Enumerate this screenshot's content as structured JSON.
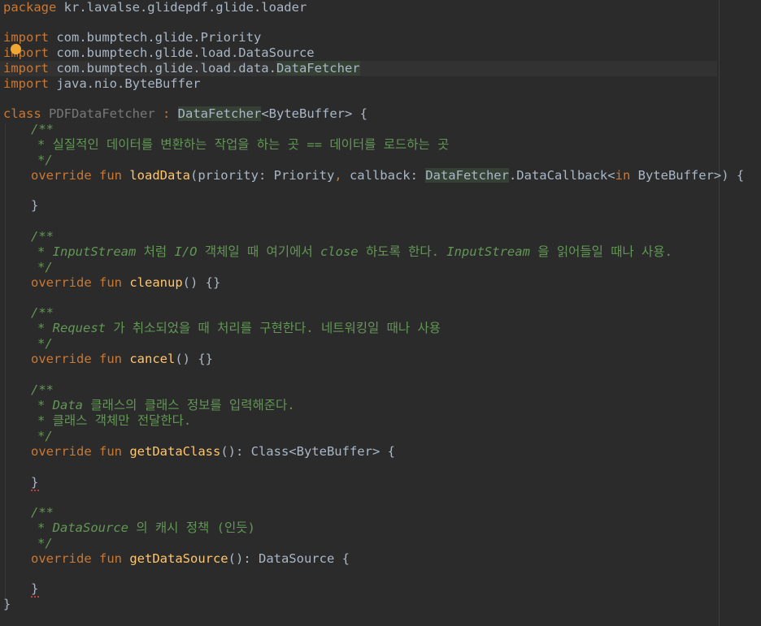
{
  "colors": {
    "background": "#2b2b2b",
    "keyword": "#cc7832",
    "doc_comment": "#629755",
    "function": "#ffc66d",
    "plain": "#a9b7c6",
    "unused_class": "#787878"
  },
  "code": {
    "l1": {
      "kw": "package",
      "rest": " kr.lavalse.glidepdf.glide.loader"
    },
    "l3": {
      "kw": "import",
      "rest": " com.bumptech.glide.Priority"
    },
    "l4": {
      "kw": "import",
      "rest": " com.bumptech.glide.load.DataSource"
    },
    "l5": {
      "kw": "import",
      "rest": " com.bumptech.glide.load.data.",
      "hl": "DataFetcher"
    },
    "l6": {
      "kw": "import",
      "rest": " java.nio.ByteBuffer"
    },
    "l8": {
      "kw": "class",
      "name": "PDFDataFetcher",
      "sep": " : ",
      "super": "DataFetcher",
      "tail": "<ByteBuffer> {"
    },
    "l9": "/**",
    "l10": "* 실질적인 데이터를 변환하는 작업을 하는 곳 == 데이터를 로드하는 곳",
    "l11": "*/",
    "l12": {
      "kw": "override fun",
      "fn": "loadData",
      "p1": "(priority: Priority",
      "comma": ",",
      "p2": " callback: ",
      "hl": "DataFetcher",
      "p3": ".DataCallback<",
      "in": "in",
      "p4": " ByteBuffer>) {"
    },
    "l14": "}",
    "l16": "/**",
    "l17": {
      "star": "* ",
      "a": "InputStream",
      "b": " 처럼 ",
      "c": "I/O",
      "d": " 객체일 때 여기에서 ",
      "e": "close",
      "f": " 하도록 한다. ",
      "g": "InputStream",
      "h": " 을 읽어들일 때나 사용."
    },
    "l18": "*/",
    "l19": {
      "kw": "override fun",
      "fn": "cleanup",
      "tail": "() {}"
    },
    "l21": "/**",
    "l22": {
      "star": "* ",
      "a": "Request",
      "b": " 가 취소되었을 때 처리를 구현한다. 네트워킹일 때나 사용"
    },
    "l23": "*/",
    "l24": {
      "kw": "override fun",
      "fn": "cancel",
      "tail": "() {}"
    },
    "l26": "/**",
    "l27": {
      "star": "* ",
      "a": "Data",
      "b": " 클래스의 클래스 정보를 입력해준다."
    },
    "l28": "* 클래스 객체만 전달한다.",
    "l29": "*/",
    "l30": {
      "kw": "override fun",
      "fn": "getDataClass",
      "tail": "(): Class<ByteBuffer> {"
    },
    "l32": "}",
    "l34": "/**",
    "l35": {
      "star": "* ",
      "a": "DataSource",
      "b": " 의 캐시 정책 (인듯)"
    },
    "l36": "*/",
    "l37": {
      "kw": "override fun",
      "fn": "getDataSource",
      "tail": "(): DataSource {"
    },
    "l39": "}",
    "l40": "}"
  }
}
